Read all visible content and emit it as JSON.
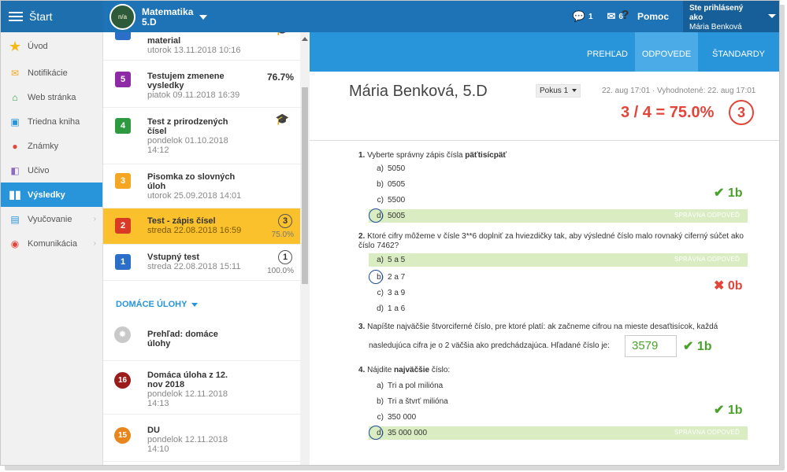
{
  "topbar": {
    "start_label": "Štart",
    "course_logo": "n/a",
    "course_name": "Matematika",
    "course_class": "5.D",
    "messages_count": "1",
    "mail_count": "6",
    "help_label": "Pomoc",
    "logged_in_label": "Ste prihlásený ako",
    "user_name": "Mária Benková"
  },
  "sidebar": {
    "items": [
      {
        "label": "Úvod"
      },
      {
        "label": "Notifikácie"
      },
      {
        "label": "Web stránka"
      },
      {
        "label": "Triedna kniha"
      },
      {
        "label": "Známky"
      },
      {
        "label": "Učivo"
      },
      {
        "label": "Výsledky"
      },
      {
        "label": "Vyučovanie"
      },
      {
        "label": "Komunikácia"
      }
    ]
  },
  "list": {
    "items": [
      {
        "num": "",
        "title": "material",
        "date": "utorok 13.11.2018 10:16",
        "score": ""
      },
      {
        "num": "5",
        "title": "Testujem zmenene vysledky",
        "date": "piatok 09.11.2018 16:39",
        "score": "76.7%"
      },
      {
        "num": "4",
        "title": "Test z prirodzených čísel",
        "date": "pondelok 01.10.2018 14:12",
        "score": ""
      },
      {
        "num": "3",
        "title": "Pisomka zo slovných úloh",
        "date": "utorok 25.09.2018 14:01",
        "score": ""
      },
      {
        "num": "2",
        "title": "Test - zápis čísel",
        "date": "streda 22.08.2018 16:59",
        "badge": "3",
        "pct": "75.0%"
      },
      {
        "num": "1",
        "title": "Vstupný test",
        "date": "streda 22.08.2018 15:11",
        "badge": "1",
        "pct": "100.0%"
      }
    ],
    "homework_title": "DOMÁCE ÚLOHY",
    "homework": [
      {
        "num": "",
        "title": "Prehľad: domáce úlohy",
        "date": ""
      },
      {
        "num": "16",
        "title": "Domáca úloha z 12. nov 2018",
        "date": "pondelok 12.11.2018 14:13"
      },
      {
        "num": "15",
        "title": "DU",
        "date": "pondelok 12.11.2018 14:10"
      }
    ]
  },
  "main": {
    "tabs": [
      {
        "label": "PREHĽAD"
      },
      {
        "label": "ODPOVEDE"
      },
      {
        "label": "ŠTANDARDY"
      }
    ],
    "student": "Mária Benková, 5.D",
    "attempt": "Pokus 1",
    "meta": "22. aug 17:01 · Vyhodnotené: 22. aug 17:01",
    "total": "3 / 4 = 75.0%",
    "total_badge": "3",
    "correct_label": "SPRÁVNA ODPOVEĎ",
    "questions": [
      {
        "num": "1.",
        "text": "Vyberte správny zápis čísla ",
        "bold": "päťtisícpäť",
        "answers": [
          "5050",
          "0505",
          "5500",
          "5005"
        ],
        "points": "1b"
      },
      {
        "num": "2.",
        "text": "Ktoré cifry môžeme v čísle 3**6 doplniť za hviezdičky tak, aby výsledné číslo malo rovnaký ciferný súčet ako číslo 7462?",
        "answers": [
          "5 a 5",
          "2 a 7",
          "3 a 9",
          "1 a 6"
        ],
        "points": "0b"
      },
      {
        "num": "3.",
        "text": "Napíšte najväčšie štvorciferné číslo, pre ktoré platí: ak začneme cifrou na mieste desaťtisícok, každá",
        "text2": "nasledujúca cifra je o 2 väčšia ako predchádzajúca. Hľadané číslo je:",
        "answer": "3579",
        "points": "1b"
      },
      {
        "num": "4.",
        "text": "Nájdite ",
        "bold": "najväčšie",
        "text_after": " číslo:",
        "answers": [
          "Tri a pol milióna",
          "Tri a štvrť milióna",
          "350 000",
          "35 000 000"
        ],
        "points": "1b"
      }
    ],
    "letters": [
      "a)",
      "b)",
      "c)",
      "d)"
    ]
  },
  "colors": {
    "topbar": "#1d73b6",
    "tabs": "#2894d9",
    "selected_item": "#fbc12d",
    "correct_bg": "#d9ecc2",
    "error": "#e2453a",
    "ok": "#4aa12b"
  }
}
